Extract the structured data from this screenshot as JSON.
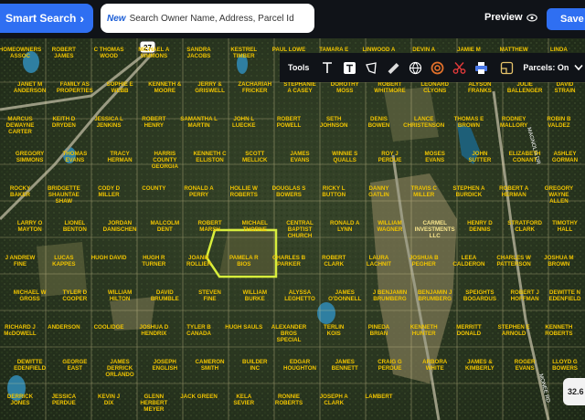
{
  "header": {
    "smart_search_label": "Smart Search",
    "search_new_tag": "New",
    "search_placeholder": "Search Owner Name, Address, Parcel Id",
    "preview_label": "Preview",
    "save_label": "Save"
  },
  "toolbar": {
    "tools_label": "Tools",
    "icons": [
      "text-icon",
      "text-box-icon",
      "polygon-icon",
      "ruler-icon",
      "globe-icon",
      "target-icon",
      "scissors-icon",
      "print-icon",
      "layer-icon"
    ],
    "parcels_label": "Parcels: On"
  },
  "map": {
    "highway_shield": "27",
    "zoom_readout": "32.6",
    "highlight_color": "#d8ee3c",
    "label_color": "#f0c400",
    "roads": [
      "MAGNOLIA DR",
      "MONEE RD"
    ],
    "parcels": [
      "HOMEOWNERS ASSOC",
      "ROBERT JAMES",
      "C THOMAS WOOD",
      "MICHAEL A SIMMONS",
      "SANDRA JACOBS",
      "KESTREL TIMBER",
      "PAUL LOWE",
      "TAMARA E GIBSON",
      "LINWOOD A LEES",
      "DEVIN A SMITH",
      "JAMIE M PARKER",
      "MATTHEW ENGLISH",
      "LINDA ANGELA MARIE DAVIS",
      "JANET M ANDERSON",
      "FAMILY AS PROPERTIES",
      "SOPHIE E WEBB",
      "KENNETH & MOORE",
      "JERRY & GRISWELL",
      "ZACHARIAH FRICKER",
      "STEPHANIE A CASEY",
      "DOROTHY MOSS",
      "ROBERT WHITMORE",
      "LEONARD CLYONS",
      "ALYSON FRANKS",
      "JULIE BALLENGER",
      "DAVID STRAIN",
      "MARCUS DEWAYNE CARTER",
      "KEITH D DRYDEN",
      "JESSICA L JENKINS",
      "ROBERT HENRY",
      "SAMANTHA L MARTIN",
      "JOHN L LUECKE",
      "ROBERT POWELL",
      "SETH JOHNSON",
      "DENIS BOWEN",
      "LANCE CHRISTENSON",
      "THOMAS E BROWN",
      "RODNEY MALLORY",
      "ROBIN B VALDEZ",
      "GREGORY SIMMONS",
      "THOMAS EVANS",
      "TRACY HERMAN",
      "HARRIS COUNTY GEORGIA",
      "KENNETH C ELLISTON",
      "SCOTT MELLICK",
      "JAMES EVANS",
      "WINNIE S QUALLS",
      "ROY J PERDUE",
      "MOSES EVANS",
      "JOHN SUTTER",
      "ELIZABETH CONANT",
      "ASHLEY GORMAN",
      "ROCKY BAKER",
      "BRIDGETTE SHAUNTAE SHAW",
      "CODY D MILLER",
      "COUNTY",
      "RONALD A PERRY",
      "HOLLIE W ROBERTS",
      "DOUGLAS S BOWERS",
      "RICKY L BUTTON",
      "DANNY GATLIN",
      "TRAVIS C MILLER",
      "STEPHEN A BURDICK",
      "ROBERT A HERMAN",
      "GREGORY WAYNE ALLEN",
      "LARRY O MAYTON",
      "LIONEL BENTON",
      "JORDAN DANISCHEN",
      "MALCOLM DENT",
      "ROBERT MARSH",
      "MICHAEL THORNE",
      "CENTRAL BAPTIST CHURCH",
      "RONALD A LYNN",
      "WILLIAM WAGNER",
      "CARMEL INVESTMENTS LLC",
      "HENRY D DENNIS",
      "STRATFORD CLARK",
      "TIMOTHY HALL",
      "J ANDREW FINE",
      "LUCAS KAPPES",
      "HUGH DAVID",
      "HUGH R TURNER",
      "JOANIE ROLLIER",
      "PAMELA R BIOS",
      "CHARLES B PARKER",
      "ROBERT CLARK",
      "LAURA LACHNIT",
      "JOSHUA B PEGHER",
      "LEEA CALDERON",
      "CHARLES W PATTERSON",
      "JOSHUA M BROWN",
      "MICHAEL W GROSS",
      "TYLER D COOPER",
      "WILLIAM HILTON",
      "DAVID BRUMBLE",
      "STEVEN FINE",
      "WILLIAM BURKE",
      "ALYSSA LEGHETTO",
      "JAMES O'DONNELL",
      "J BENJAMIN BRUMBERG",
      "BENJAMIN J BRUMBERG",
      "SPEIGHTS BOGARDUS",
      "ROBERT J HOFFMAN",
      "DEWITTE N EDENFIELD",
      "RICHARD J McDOWELL",
      "ANDERSON",
      "COOLIDGE",
      "JOSHUA D HENDRIX",
      "TYLER B CANADA",
      "HUGH SAULS",
      "ALEXANDER BROS SPECIAL",
      "TERLIN KOIS",
      "PINEDA BRIAN",
      "KENNETH HUNTER",
      "MERRITT DONALD",
      "STEPHEN E ARNOLD",
      "KENNETH ROBERTS",
      "DEWITTE EDENFIELD",
      "GEORGE EAST",
      "JAMES DERRICK ORLANDO",
      "JOSEPH ENGLISH",
      "CAMERON SMITH",
      "BUILDER INC",
      "EDGAR HOUGHTON",
      "JAMES BENNETT",
      "CRAIG G PERDUE",
      "ARBORA WHITE",
      "JAMES & KIMBERLY",
      "ROGER EVANS",
      "LLOYD G BOWERS",
      "DERRICK JONES",
      "JESSICA PERDUE",
      "KEVIN J DIX",
      "GLENN HERBERT MEYER",
      "JACK GREEN",
      "KELA SEVIER",
      "RONNIE ROBERTS",
      "JOSEPH A CLARK",
      "LAMBERT"
    ]
  }
}
